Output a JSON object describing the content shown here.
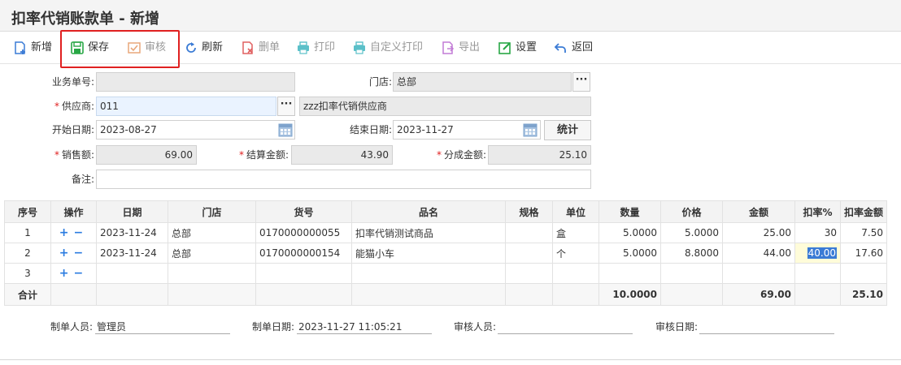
{
  "window": {
    "title": "扣率代销账款单 - 新增"
  },
  "toolbar": {
    "add": "新增",
    "save": "保存",
    "audit": "审核",
    "refresh": "刷新",
    "delete": "删单",
    "print": "打印",
    "custom_print": "自定义打印",
    "export": "导出",
    "settings": "设置",
    "back": "返回"
  },
  "form": {
    "doc_no_label": "业务单号:",
    "doc_no_value": "",
    "store_label": "门店:",
    "store_value": "总部",
    "supplier_label": "供应商:",
    "supplier_code": "011",
    "supplier_name": "zzz扣率代销供应商",
    "start_date_label": "开始日期:",
    "start_date": "2023-08-27",
    "end_date_label": "结束日期:",
    "end_date": "2023-11-27",
    "stat_button": "统计",
    "sales_label": "销售额:",
    "sales_value": "69.00",
    "settle_label": "结算金额:",
    "settle_value": "43.90",
    "share_label": "分成金额:",
    "share_value": "25.10",
    "remark_label": "备注:",
    "remark_value": ""
  },
  "grid": {
    "headers": [
      "序号",
      "操作",
      "日期",
      "门店",
      "货号",
      "品名",
      "规格",
      "单位",
      "数量",
      "价格",
      "金额",
      "扣率%",
      "扣率金额"
    ],
    "rows": [
      {
        "no": "1",
        "date": "2023-11-24",
        "store": "总部",
        "code": "0170000000055",
        "name": "扣率代销测试商品",
        "spec": "",
        "unit": "盒",
        "qty": "5.0000",
        "price": "5.0000",
        "amount": "25.00",
        "rate": "30",
        "rate_amount": "7.50"
      },
      {
        "no": "2",
        "date": "2023-11-24",
        "store": "总部",
        "code": "0170000000154",
        "name": "能猫小车",
        "spec": "",
        "unit": "个",
        "qty": "5.0000",
        "price": "8.8000",
        "amount": "44.00",
        "rate": "40.00",
        "rate_amount": "17.60"
      },
      {
        "no": "3",
        "date": "",
        "store": "",
        "code": "",
        "name": "",
        "spec": "",
        "unit": "",
        "qty": "",
        "price": "",
        "amount": "",
        "rate": "",
        "rate_amount": ""
      }
    ],
    "op_add": "+",
    "op_remove": "−",
    "total_label": "合计",
    "total_qty": "10.0000",
    "total_amount": "69.00",
    "total_rate_amount": "25.10"
  },
  "footer": {
    "creator_label": "制单人员:",
    "creator": "管理员",
    "create_date_label": "制单日期:",
    "create_date": "2023-11-27 11:05:21",
    "auditor_label": "审核人员:",
    "auditor": "",
    "audit_date_label": "审核日期:",
    "audit_date": ""
  },
  "colors": {
    "accent": "#2a7be0",
    "highlight_border": "#e02020",
    "required": "#e02020"
  },
  "icons": [
    "add-doc-icon",
    "save-icon",
    "audit-icon",
    "refresh-icon",
    "delete-doc-icon",
    "print-icon",
    "export-icon",
    "settings-icon",
    "back-icon",
    "calendar-icon"
  ]
}
